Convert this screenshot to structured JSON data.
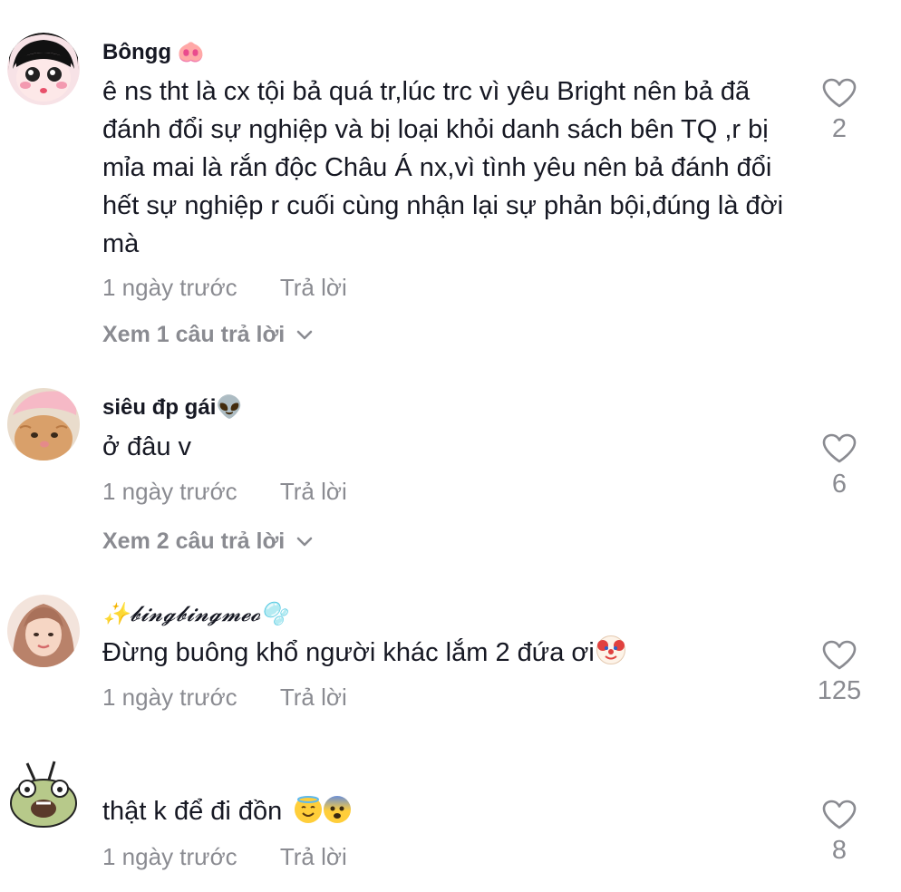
{
  "comments": [
    {
      "username": "Bôngg 🐽",
      "text": "ê ns tht là cx tội bả quá tr,lúc trc vì yêu Bright nên bả đã đánh đổi sự nghiệp và bị loại khỏi danh sách bên TQ ,r bị mỉa mai là rắn độc Châu Á nx,vì tình yêu nên bả đánh đổi hết sự nghiệp r cuối cùng nhận lại sự phản bội,đúng là đời mà",
      "time": "1 ngày trước",
      "reply_label": "Trả lời",
      "likes": "2",
      "view_replies": "Xem 1 câu trả lời"
    },
    {
      "username": "siêu đp gái👽",
      "text": "ở đâu v",
      "time": "1 ngày trước",
      "reply_label": "Trả lời",
      "likes": "6",
      "view_replies": "Xem 2 câu trả lời"
    },
    {
      "username": "✨𝓫𝓲𝓷𝓰𝓫𝓲𝓷𝓰𝓶𝓮𝓸🫧",
      "text": "Đừng buông khổ người khác lắm 2 đứa ơi",
      "text_emoji": "clown-face",
      "time": "1 ngày trước",
      "reply_label": "Trả lời",
      "likes": "125"
    },
    {
      "username": "",
      "text": "thật k để đi đồn",
      "text_emoji": "smiling-halo-face, fearful-face",
      "time": "1 ngày trước",
      "reply_label": "Trả lời",
      "likes": "8"
    }
  ],
  "colors": {
    "primary_text": "#161823",
    "secondary_text": "#8a8b91",
    "background": "#ffffff"
  }
}
